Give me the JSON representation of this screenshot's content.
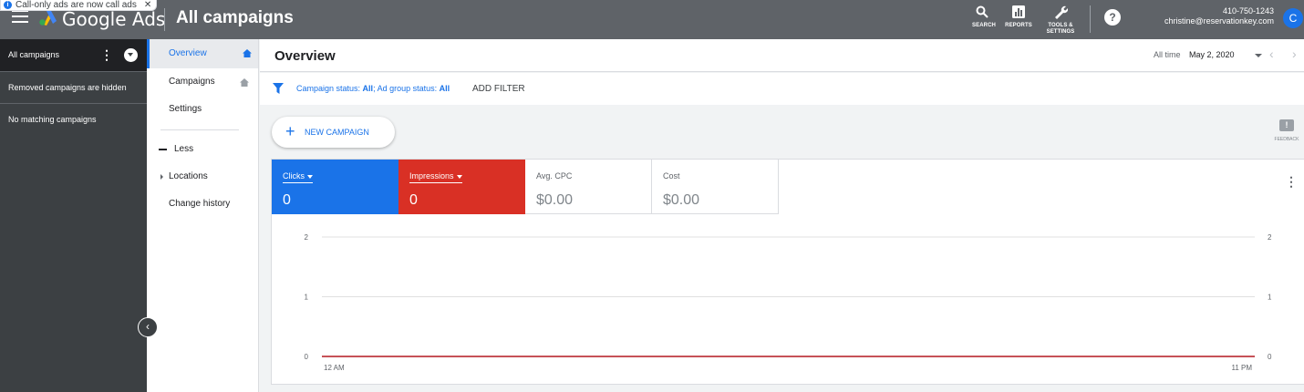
{
  "toast": {
    "text": "Call-only ads are now call ads",
    "close": "✕"
  },
  "topbar": {
    "brand": "Google Ads",
    "title": "All campaigns",
    "actions": [
      {
        "label": "SEARCH",
        "icon": "search-icon"
      },
      {
        "label": "REPORTS",
        "icon": "reports-icon"
      },
      {
        "label": "TOOLS &",
        "label2": "SETTINGS",
        "icon": "tools-icon"
      }
    ],
    "help": "?",
    "account": {
      "phone": "410-750-1243",
      "email": "christine@reservationkey.com",
      "initial": "C"
    }
  },
  "campaign_panel": {
    "header": "All campaigns",
    "removed_note": "Removed campaigns are hidden",
    "empty": "No matching campaigns"
  },
  "nav": {
    "items": [
      "Overview",
      "Campaigns",
      "Settings"
    ],
    "less": "Less",
    "more_items": [
      "Locations",
      "Change history"
    ]
  },
  "page": {
    "title": "Overview",
    "date_range_label": "All time",
    "date_value": "May 2, 2020"
  },
  "filter": {
    "prefix1": "Campaign status: ",
    "value1": "All",
    "prefix2": "; Ad group status: ",
    "value2": "All",
    "add": "ADD FILTER"
  },
  "new_campaign": {
    "plus": "+",
    "label": "NEW CAMPAIGN"
  },
  "feedback": {
    "label": "FEEDBACK"
  },
  "metrics": [
    {
      "label": "Clicks",
      "value": "0",
      "color": "#1a73e8"
    },
    {
      "label": "Impressions",
      "value": "0",
      "color": "#d93025"
    },
    {
      "label": "Avg. CPC",
      "value": "$0.00"
    },
    {
      "label": "Cost",
      "value": "$0.00"
    }
  ],
  "chart_data": {
    "type": "line",
    "x": [
      "12 AM",
      "11 PM"
    ],
    "yticks": [
      0,
      1,
      2
    ],
    "ylim": [
      0,
      2
    ],
    "series": [
      {
        "name": "Clicks",
        "values": [
          0,
          0
        ],
        "color": "#1a73e8"
      },
      {
        "name": "Impressions",
        "values": [
          0,
          0
        ],
        "color": "#d93025"
      }
    ],
    "grid": true
  }
}
